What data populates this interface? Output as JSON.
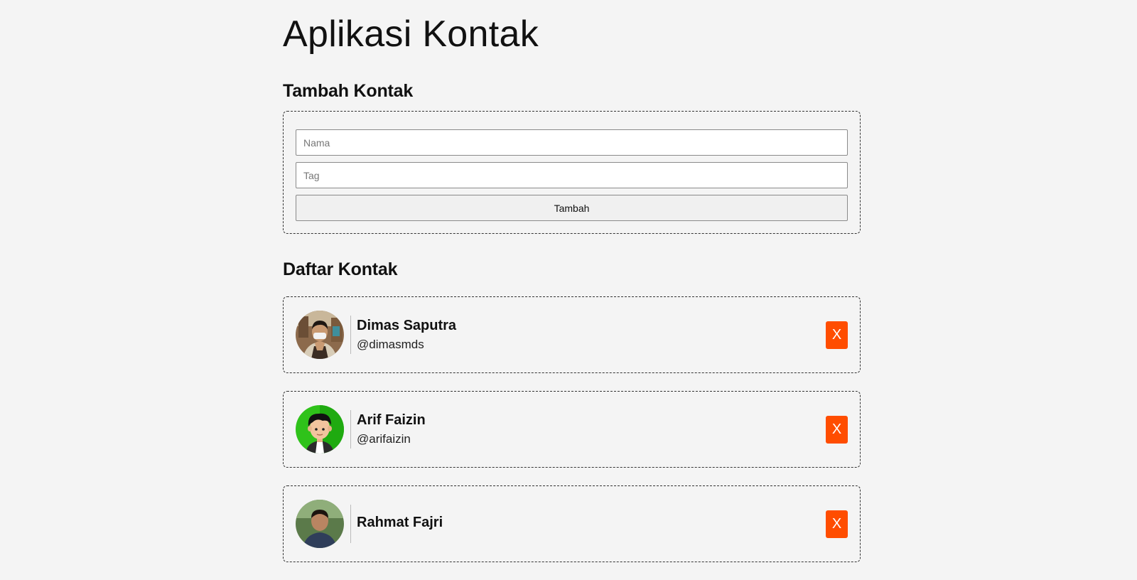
{
  "app": {
    "title": "Aplikasi Kontak"
  },
  "add_form": {
    "title": "Tambah Kontak",
    "name_placeholder": "Nama",
    "tag_placeholder": "Tag",
    "submit_label": "Tambah"
  },
  "contacts": {
    "title": "Daftar Kontak",
    "delete_label": "X",
    "accent_color": "#ff4d00",
    "items": [
      {
        "name": "Dimas Saputra",
        "tag": "@dimasmds",
        "avatar": "photo-avatar-icon"
      },
      {
        "name": "Arif Faizin",
        "tag": "@arifaizin",
        "avatar": "cartoon-avatar-icon"
      },
      {
        "name": "Rahmat Fajri",
        "tag": "",
        "avatar": "photo-avatar-icon"
      }
    ]
  }
}
